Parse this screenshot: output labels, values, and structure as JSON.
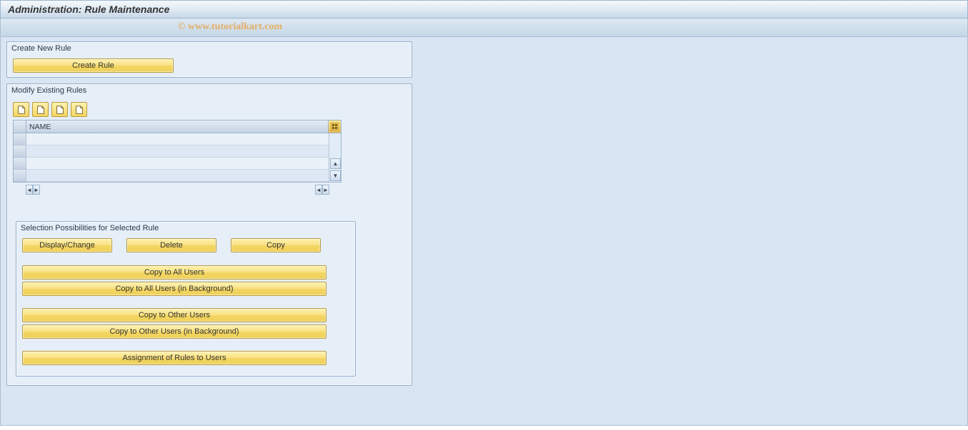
{
  "header": {
    "title": "Administration: Rule Maintenance",
    "watermark": "© www.tutorialkart.com"
  },
  "panels": {
    "create": {
      "title": "Create New Rule",
      "create_button": "Create Rule"
    },
    "modify": {
      "title": "Modify Existing Rules",
      "toolbar_icons": [
        {
          "name": "page-icon-1"
        },
        {
          "name": "page-icon-2"
        },
        {
          "name": "page-icon-3"
        },
        {
          "name": "page-icon-4"
        }
      ],
      "column_header": "NAME",
      "rows": [
        "",
        "",
        "",
        ""
      ]
    },
    "selection": {
      "title": "Selection Possibilities for Selected Rule",
      "buttons": {
        "display_change": "Display/Change",
        "delete": "Delete",
        "copy": "Copy",
        "copy_all": "Copy to All Users",
        "copy_all_bg": "Copy to All Users (in Background)",
        "copy_other": "Copy to Other Users",
        "copy_other_bg": "Copy to Other Users (in Background)",
        "assignment": "Assignment of Rules to Users"
      }
    }
  }
}
